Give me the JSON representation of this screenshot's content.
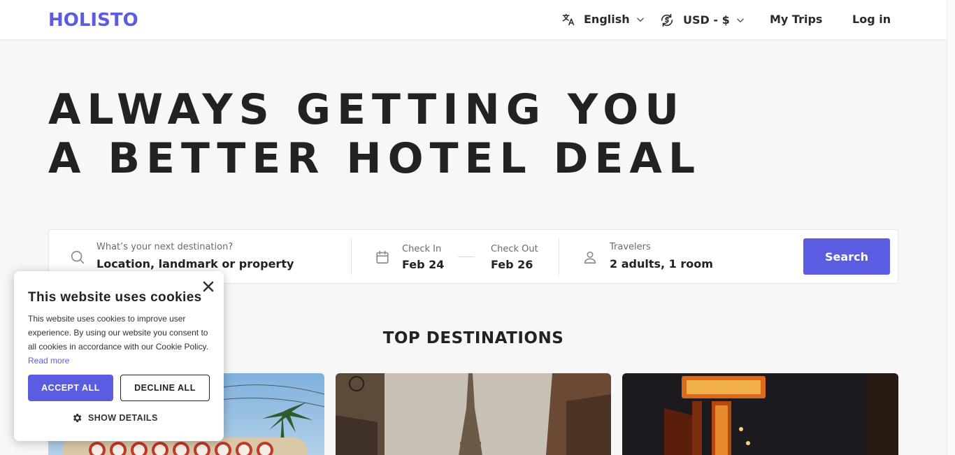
{
  "brand": {
    "logo_text": "HOLISTO",
    "accent_color": "#5b5ce2"
  },
  "header": {
    "language_label": "English",
    "currency_label": "USD - $",
    "my_trips_label": "My Trips",
    "login_label": "Log in",
    "language_icon": "translate-icon",
    "currency_icon": "currency-exchange-icon"
  },
  "hero": {
    "line1": "ALWAYS GETTING YOU",
    "line2": "A BETTER HOTEL DEAL"
  },
  "search": {
    "destination_label": "What’s your next destination?",
    "destination_placeholder": "Location, landmark or property",
    "check_in_label": "Check In",
    "check_in_value": "Feb 24",
    "check_out_label": "Check Out",
    "check_out_value": "Feb 26",
    "travelers_label": "Travelers",
    "travelers_value": "2 adults, 1 room",
    "search_button": "Search"
  },
  "destinations": {
    "heading": "TOP DESTINATIONS",
    "cards": [
      {
        "image": "las-vegas-welcome-sign"
      },
      {
        "image": "paris-eiffel-tower"
      },
      {
        "image": "bangkok-chinatown-neon"
      }
    ]
  },
  "cookie_banner": {
    "title": "This website uses cookies",
    "body": "This website uses cookies to improve user experience. By using our website you consent to all cookies in accordance with our Cookie Policy.",
    "read_more": "Read more",
    "accept_all": "ACCEPT ALL",
    "decline_all": "DECLINE ALL",
    "show_details": "SHOW DETAILS"
  }
}
